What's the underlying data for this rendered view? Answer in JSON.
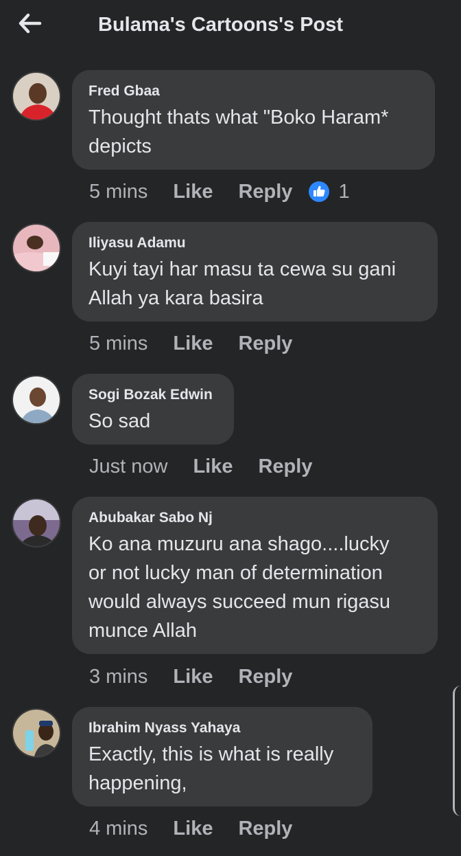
{
  "header": {
    "title": "Bulama's Cartoons's Post",
    "back_icon": "back-arrow-icon"
  },
  "colors": {
    "background": "#242526",
    "bubble": "#3a3b3c",
    "meta_text": "#b0b3b8",
    "reaction_blue": "#2d88ff"
  },
  "comments": [
    {
      "author": "Fred Gbaa",
      "text": "Thought thats what \"Boko Haram*\ndepicts",
      "time": "5 mins",
      "like_label": "Like",
      "reply_label": "Reply",
      "reaction_icon": "like-reaction-icon",
      "reaction_count": "1"
    },
    {
      "author": "Iliyasu Adamu",
      "text": "Kuyi tayi har masu ta cewa su gani\nAllah ya kara basira",
      "time": "5 mins",
      "like_label": "Like",
      "reply_label": "Reply"
    },
    {
      "author": "Sogi Bozak Edwin",
      "text": "So sad",
      "time": "Just now",
      "like_label": "Like",
      "reply_label": "Reply"
    },
    {
      "author": "Abubakar Sabo Nj",
      "text": "Ko ana muzuru ana shago....lucky\nor not lucky man of determination\nwould always succeed mun rigasu\nmunce Allah",
      "time": "3 mins",
      "like_label": "Like",
      "reply_label": "Reply"
    },
    {
      "author": "Ibrahim Nyass Yahaya",
      "text": "Exactly, this is what is really\nhappening,",
      "time": "4 mins",
      "like_label": "Like",
      "reply_label": "Reply"
    }
  ]
}
